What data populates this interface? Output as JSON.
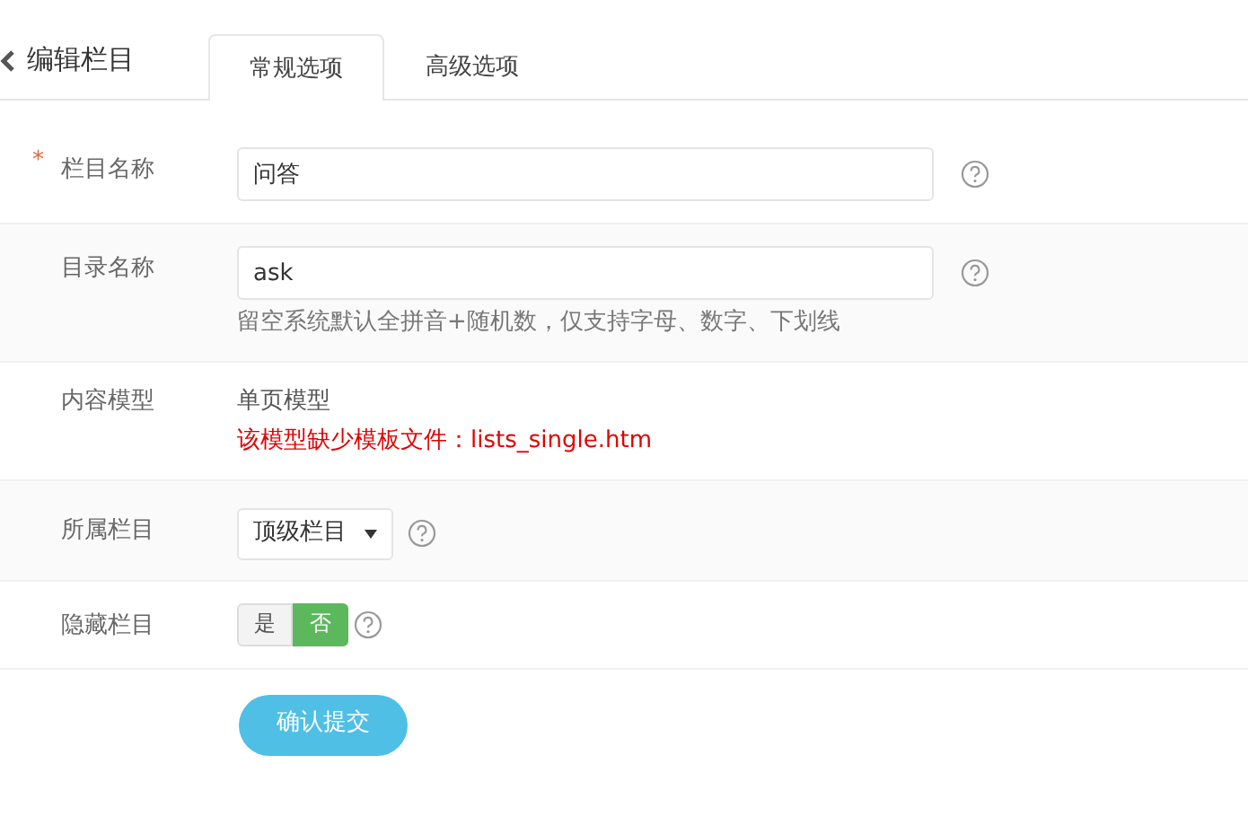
{
  "header": {
    "title": "编辑栏目"
  },
  "tabs": [
    {
      "label": "常规选项",
      "selected": true
    },
    {
      "label": "高级选项",
      "selected": false
    }
  ],
  "fields": [
    {
      "kind": "text",
      "required_mark": "*",
      "label": "栏目名称",
      "value": "问答",
      "help": true
    },
    {
      "kind": "text",
      "label": "目录名称",
      "value": "ask",
      "help": true,
      "hint": "留空系统默认全拼音+随机数，仅支持字母、数字、下划线"
    },
    {
      "kind": "static",
      "label": "内容模型",
      "value": "单页模型",
      "warning": "该模型缺少模板文件：lists_single.htm"
    },
    {
      "kind": "select",
      "label": "所属栏目",
      "value": "顶级栏目",
      "help": true
    },
    {
      "kind": "toggle",
      "label": "隐藏栏目",
      "help": true,
      "options": [
        {
          "label": "是",
          "selected": false
        },
        {
          "label": "否",
          "selected": true
        }
      ]
    }
  ],
  "submit": "确认提交"
}
